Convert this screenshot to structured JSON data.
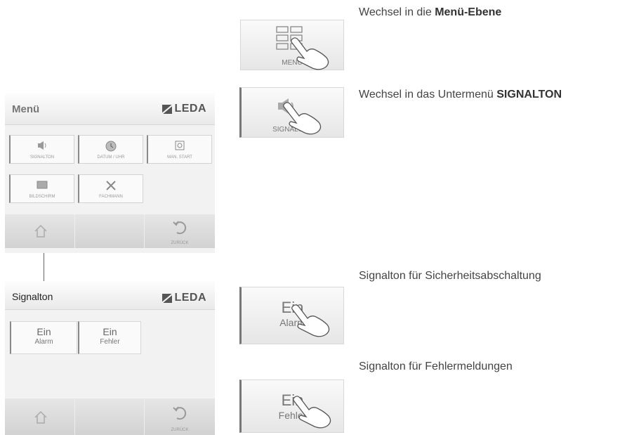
{
  "menu_screen": {
    "title": "Menü",
    "brand": "LEDA",
    "tiles": [
      {
        "label": "SIGNALTON",
        "icon": "speaker-icon"
      },
      {
        "label": "DATUM / UHR",
        "icon": "clock-icon"
      },
      {
        "label": "MAN. START",
        "icon": "power-icon"
      },
      {
        "label": "BILDSCHIRM",
        "icon": "screen-icon"
      },
      {
        "label": "FACHMANN",
        "icon": "tools-icon"
      }
    ],
    "nav": {
      "back_label": "ZURÜCK"
    }
  },
  "signal_screen": {
    "title": "Signalton",
    "brand": "LEDA",
    "tiles": [
      {
        "line1": "Ein",
        "line2": "Alarm"
      },
      {
        "line1": "Ein",
        "line2": "Fehler"
      }
    ],
    "nav": {
      "back_label": "ZURÜCK"
    }
  },
  "zoom_buttons": {
    "menu": "MENÜ",
    "signalton": "SIGNALTON",
    "alarm": {
      "line1": "Ein",
      "line2": "Alarm"
    },
    "fehler": {
      "line1": "Ein",
      "line2": "Fehler"
    }
  },
  "descriptions": {
    "menu_prefix": "Wechsel in die ",
    "menu_bold": "Menü-Ebene",
    "signalton_prefix": "Wechsel in das Untermenü ",
    "signalton_bold": "SIGNALTON",
    "alarm": "Signalton für Sicherheitsabschaltung",
    "fehler": "Signalton für Fehlermeldungen"
  },
  "colors": {
    "accent": "#777777",
    "background": "#ffffff",
    "panel": "#f2f2f2"
  }
}
